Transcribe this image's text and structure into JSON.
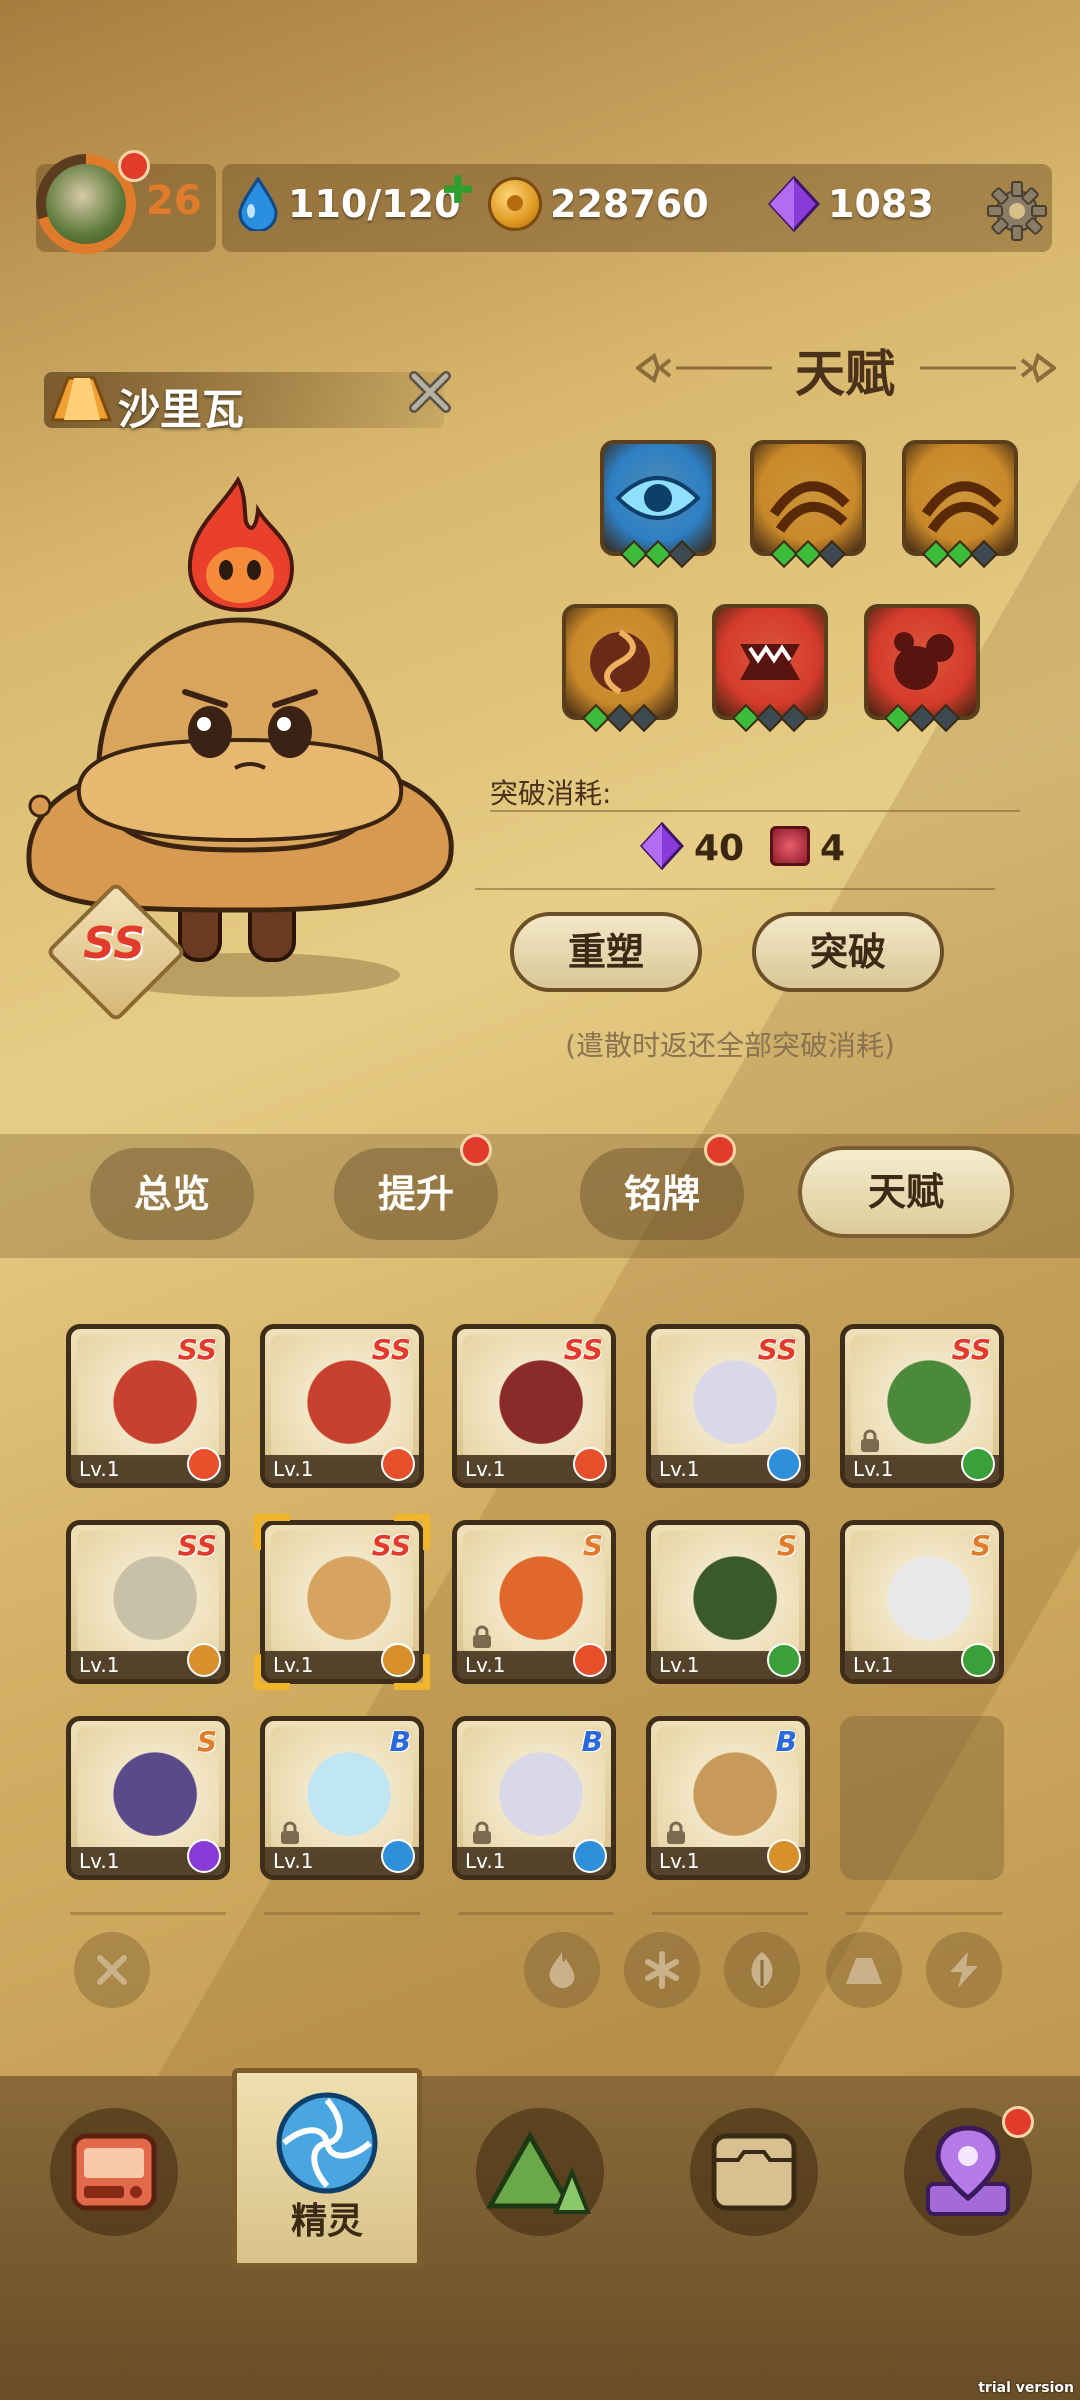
{
  "header": {
    "level": "26",
    "stamina": "110/120",
    "coins": "228760",
    "gems": "1083"
  },
  "hero": {
    "name": "沙里瓦",
    "rank": "SS"
  },
  "talent": {
    "title": "天赋",
    "icons": [
      {
        "name": "eye",
        "level": 2,
        "max": 3,
        "color": "#2d7fc4"
      },
      {
        "name": "crescent",
        "level": 2,
        "max": 3,
        "color": "#c9892a"
      },
      {
        "name": "crescent",
        "level": 2,
        "max": 3,
        "color": "#c9892a"
      },
      {
        "name": "swirl",
        "level": 1,
        "max": 3,
        "color": "#c9892a"
      },
      {
        "name": "fang",
        "level": 1,
        "max": 3,
        "color": "#d63b2b"
      },
      {
        "name": "bubbles",
        "level": 1,
        "max": 3,
        "color": "#d63b2b"
      }
    ],
    "cost_label": "突破消耗:",
    "cost_gem": "40",
    "cost_book": "4",
    "reset_button": "重塑",
    "breakthrough_button": "突破",
    "note": "(遣散时返还全部突破消耗)"
  },
  "tabs": [
    {
      "label": "总览",
      "dot": false
    },
    {
      "label": "提升",
      "dot": true
    },
    {
      "label": "铭牌",
      "dot": true
    },
    {
      "label": "天赋",
      "dot": false,
      "active": true
    }
  ],
  "roster": [
    {
      "rank": "SS",
      "level": "Lv.1",
      "element": "fire",
      "art": "#c8402e",
      "lock": false
    },
    {
      "rank": "SS",
      "level": "Lv.1",
      "element": "fire",
      "art": "#c8402e",
      "lock": false
    },
    {
      "rank": "SS",
      "level": "Lv.1",
      "element": "fire",
      "art": "#8a2a2a",
      "lock": false
    },
    {
      "rank": "SS",
      "level": "Lv.1",
      "element": "ice",
      "art": "#d8d8e8",
      "lock": false
    },
    {
      "rank": "SS",
      "level": "Lv.1",
      "element": "leaf",
      "art": "#4a8a3a",
      "lock": true
    },
    {
      "rank": "SS",
      "level": "Lv.1",
      "element": "earth",
      "art": "#c9c0a8",
      "lock": false
    },
    {
      "rank": "SS",
      "level": "Lv.1",
      "element": "earth",
      "art": "#d6a460",
      "lock": false,
      "selected": true
    },
    {
      "rank": "S",
      "level": "Lv.1",
      "element": "fire",
      "art": "#e0682c",
      "lock": true
    },
    {
      "rank": "S",
      "level": "Lv.1",
      "element": "leaf",
      "art": "#3b5a2a",
      "lock": false
    },
    {
      "rank": "S",
      "level": "Lv.1",
      "element": "leaf",
      "art": "#e8e8e8",
      "lock": false
    },
    {
      "rank": "S",
      "level": "Lv.1",
      "element": "bolt",
      "art": "#5a4a8a",
      "lock": false
    },
    {
      "rank": "B",
      "level": "Lv.1",
      "element": "ice",
      "art": "#bfe6f2",
      "lock": true
    },
    {
      "rank": "B",
      "level": "Lv.1",
      "element": "ice",
      "art": "#d8d8e8",
      "lock": true
    },
    {
      "rank": "B",
      "level": "Lv.1",
      "element": "earth",
      "art": "#c89a5a",
      "lock": true
    }
  ],
  "elements": {
    "fire": "#e8502b",
    "ice": "#2f8fd8",
    "leaf": "#3aa03a",
    "earth": "#d8902a",
    "bolt": "#8a3ad8"
  },
  "nav": {
    "active_label": "精灵"
  },
  "watermark": "trial version"
}
